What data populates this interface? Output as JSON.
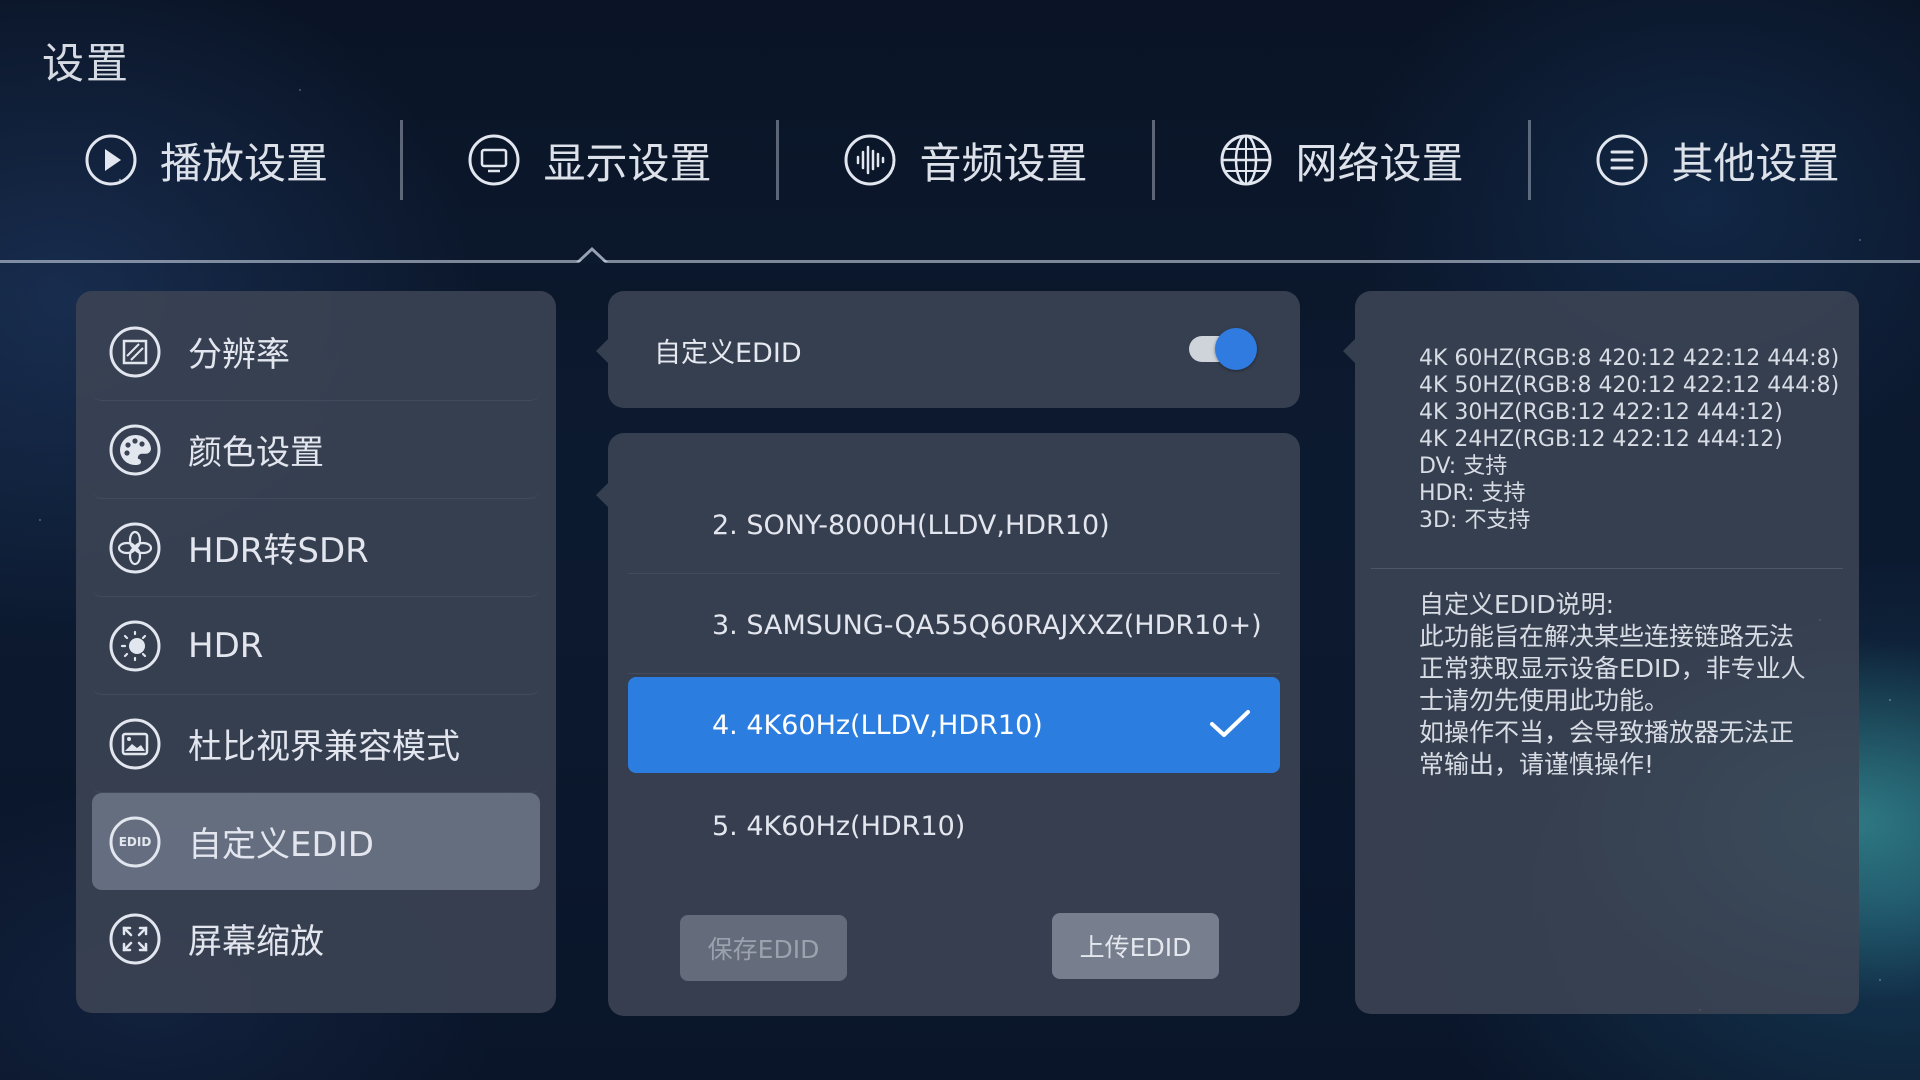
{
  "page_title": "设置",
  "tabs": [
    {
      "label": "播放设置",
      "icon": "play-icon"
    },
    {
      "label": "显示设置",
      "icon": "monitor-icon"
    },
    {
      "label": "音频设置",
      "icon": "audio-wave-icon"
    },
    {
      "label": "网络设置",
      "icon": "globe-icon"
    },
    {
      "label": "其他设置",
      "icon": "menu-lines-icon"
    }
  ],
  "active_tab": "显示设置",
  "sidebar": {
    "items": [
      {
        "label": "分辨率",
        "icon": "resolution-icon"
      },
      {
        "label": "颜色设置",
        "icon": "palette-icon"
      },
      {
        "label": "HDR转SDR",
        "icon": "aperture-icon"
      },
      {
        "label": "HDR",
        "icon": "hdr-sun-icon"
      },
      {
        "label": "杜比视界兼容模式",
        "icon": "image-frame-icon"
      },
      {
        "label": "自定义EDID",
        "icon": "edid-icon",
        "icon_text": "EDID",
        "active": true
      },
      {
        "label": "屏幕缩放",
        "icon": "expand-arrows-icon"
      }
    ]
  },
  "edid_toggle": {
    "label": "自定义EDID",
    "enabled": true
  },
  "edid_list": {
    "items": [
      {
        "label": "2. SONY-8000H(LLDV,HDR10)",
        "selected": false
      },
      {
        "label": "3. SAMSUNG-QA55Q60RAJXXZ(HDR10+)",
        "selected": false
      },
      {
        "label": "4. 4K60Hz(LLDV,HDR10)",
        "selected": true
      },
      {
        "label": "5. 4K60Hz(HDR10)",
        "selected": false
      }
    ],
    "save_label": "保存EDID",
    "upload_label": "上传EDID"
  },
  "info": {
    "capabilities": [
      "4K 60HZ(RGB:8 420:12 422:12 444:8)",
      "4K 50HZ(RGB:8 420:12 422:12 444:8)",
      "4K 30HZ(RGB:12 422:12 444:12)",
      "4K 24HZ(RGB:12 422:12 444:12)",
      "DV: 支持",
      "HDR: 支持",
      "3D: 不支持"
    ],
    "description_lines": [
      "自定义EDID说明:",
      "此功能旨在解决某些连接链路无法",
      "正常获取显示设备EDID，非专业人",
      "士请勿先使用此功能。",
      "如操作不当，会导致播放器无法正",
      "常输出，请谨慎操作!"
    ]
  },
  "colors": {
    "accent": "#2b7de0",
    "panel": "#3c4454",
    "active_item": "#8c96a8"
  }
}
